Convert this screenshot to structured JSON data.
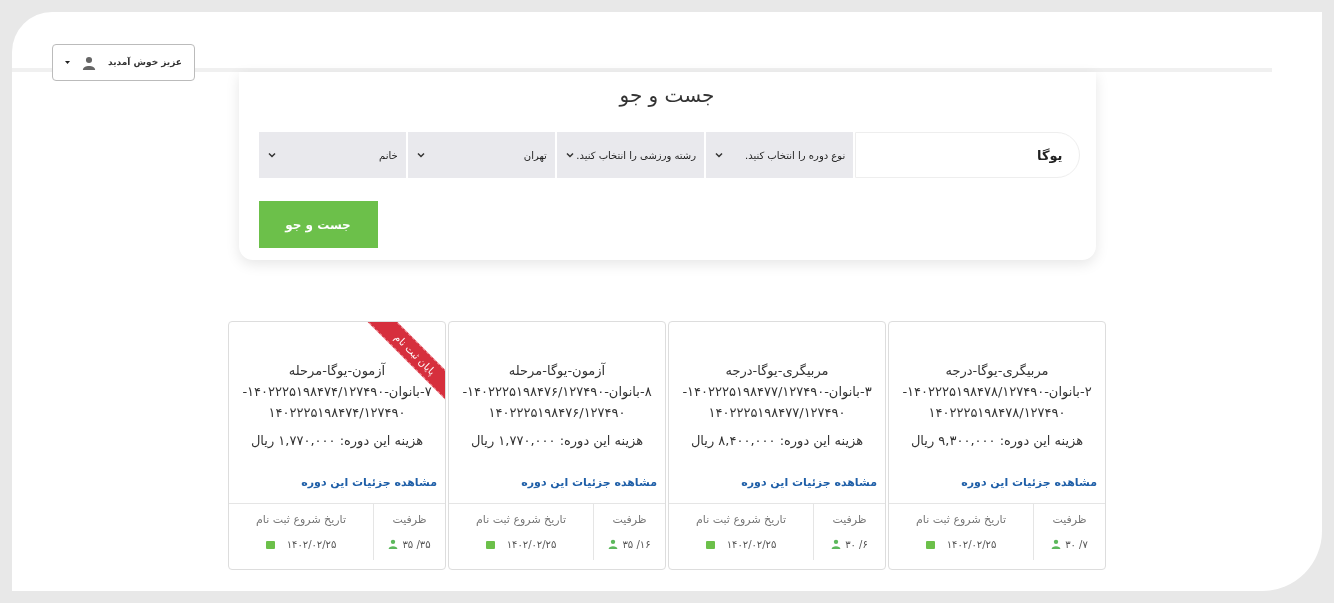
{
  "user_menu": {
    "label": "عزیز خوش آمدید"
  },
  "search": {
    "title": "جست و جو",
    "fields": [
      {
        "kind": "input",
        "value": "یوگا"
      },
      {
        "kind": "select",
        "value": "نوع دوره را انتخاب کنید."
      },
      {
        "kind": "select",
        "value": "رشته ورزشی را انتخاب کنید."
      },
      {
        "kind": "select",
        "value": "تهران"
      },
      {
        "kind": "select",
        "value": "خانم"
      }
    ],
    "button": "جست و جو"
  },
  "courses": [
    {
      "title_lines": [
        "مربیگری-یوگا-درجه",
        "۲-بانوان-۱۴۰۲۲۲۵۱۹۸۴۷۸/۱۲۷۴۹۰-",
        "۱۴۰۲۲۲۵۱۹۸۴۷۸/۱۲۷۴۹۰"
      ],
      "price": "هزینه این دوره: ۹,۳۰۰,۰۰۰ ریال",
      "link": "مشاهده جزئیات این دوره",
      "capacity_label": "ظرفیت",
      "capacity": "۳۰ /۷",
      "date_label": "تاریخ شروع ثبت نام",
      "date": "۱۴۰۲/۰۲/۲۵"
    },
    {
      "title_lines": [
        "مربیگری-یوگا-درجه",
        "۳-بانوان-۱۴۰۲۲۲۵۱۹۸۴۷۷/۱۲۷۴۹۰-",
        "۱۴۰۲۲۲۵۱۹۸۴۷۷/۱۲۷۴۹۰"
      ],
      "price": "هزینه این دوره: ۸,۴۰۰,۰۰۰ ریال",
      "link": "مشاهده جزئیات این دوره",
      "capacity_label": "ظرفیت",
      "capacity": "۳۰ /۶",
      "date_label": "تاریخ شروع ثبت نام",
      "date": "۱۴۰۲/۰۲/۲۵"
    },
    {
      "title_lines": [
        "آزمون-یوگا-مرحله",
        "۸-بانوان-۱۴۰۲۲۲۵۱۹۸۴۷۶/۱۲۷۴۹۰-",
        "۱۴۰۲۲۲۵۱۹۸۴۷۶/۱۲۷۴۹۰"
      ],
      "price": "هزینه این دوره: ۱,۷۷۰,۰۰۰ ریال",
      "link": "مشاهده جزئیات این دوره",
      "capacity_label": "ظرفیت",
      "capacity": "۳۵ /۱۶",
      "date_label": "تاریخ شروع ثبت نام",
      "date": "۱۴۰۲/۰۲/۲۵"
    },
    {
      "title_lines": [
        "آزمون-یوگا-مرحله",
        "۷-بانوان-۱۴۰۲۲۲۵۱۹۸۴۷۴/۱۲۷۴۹۰-",
        "۱۴۰۲۲۲۵۱۹۸۴۷۴/۱۲۷۴۹۰"
      ],
      "price": "هزینه این دوره: ۱,۷۷۰,۰۰۰ ریال",
      "link": "مشاهده جزئیات این دوره",
      "capacity_label": "ظرفیت",
      "capacity": "۳۵ /۳۵",
      "date_label": "تاریخ شروع ثبت نام",
      "date": "۱۴۰۲/۰۲/۲۵",
      "ribbon": "پایان ثبت نام"
    }
  ]
}
